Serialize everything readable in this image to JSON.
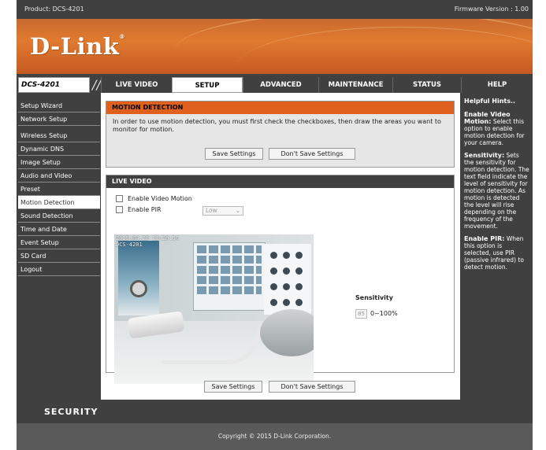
{
  "header": {
    "product": "Product: DCS-4201",
    "firmware": "Firmware Version : 1.00",
    "logo": "D-Link"
  },
  "nav": {
    "model": "DCS-4201",
    "tabs": [
      {
        "label": "LIVE VIDEO"
      },
      {
        "label": "SETUP"
      },
      {
        "label": "ADVANCED"
      },
      {
        "label": "MAINTENANCE"
      },
      {
        "label": "STATUS"
      },
      {
        "label": "HELP"
      }
    ]
  },
  "sidebar": {
    "items": [
      {
        "label": "Setup Wizard"
      },
      {
        "label": "Network Setup"
      },
      {
        "label": "Wireless Setup"
      },
      {
        "label": "Dynamic DNS"
      },
      {
        "label": "Image Setup"
      },
      {
        "label": "Audio and Video"
      },
      {
        "label": "Preset"
      },
      {
        "label": "Motion Detection"
      },
      {
        "label": "Sound Detection"
      },
      {
        "label": "Time and Date"
      },
      {
        "label": "Event Setup"
      },
      {
        "label": "SD Card"
      },
      {
        "label": "Logout"
      }
    ]
  },
  "motion": {
    "title": "MOTION DETECTION",
    "description": "In order to use motion detection, you must first check the checkboxes, then draw the areas you want to monitor for motion.",
    "save": "Save Settings",
    "dont_save": "Don't Save Settings"
  },
  "live": {
    "title": "LIVE VIDEO",
    "enable_motion": "Enable Video Motion",
    "enable_pir": "Enable PIR",
    "pir_level": "Low",
    "osd_time": "2015.04.23 13:29:56",
    "osd_model": "DCS-4201",
    "sensitivity_label": "Sensitivity",
    "sensitivity_value": "85",
    "sensitivity_range": "0~100%"
  },
  "bottom_buttons": {
    "save": "Save Settings",
    "dont_save": "Don't Save Settings"
  },
  "hints": {
    "title": "Helpful Hints..",
    "motion_title": "Enable Video Motion:",
    "motion_text": "Select this option to enable motion detection for your camera.",
    "sens_title": "Sensitivity:",
    "sens_text": "Sets the sensitivity for motion detection. The text field indicate the level of sensitivity for motion detection. As motion is detected the level will rise depending on the frequency of the movement.",
    "pir_title": "Enable PIR:",
    "pir_text": "When this option is selected, use PIR (passive infrared) to detect motion."
  },
  "footer": {
    "brand": "SECURITY",
    "copyright": "Copyright © 2015 D-Link Corporation."
  }
}
